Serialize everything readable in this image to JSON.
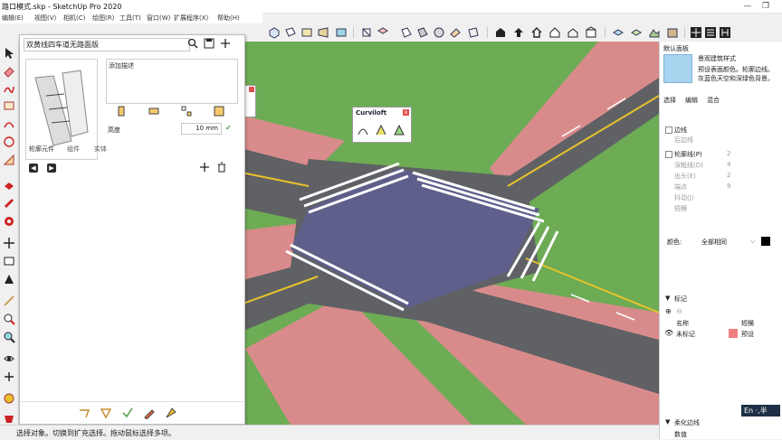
{
  "window": {
    "title": "路口模式.skp - SketchUp Pro 2020",
    "minimize": "—",
    "maximize": "❐"
  },
  "menubar": [
    "编辑(E)",
    "视图(V)",
    "相机(C)",
    "绘图(R)",
    "工具(T)",
    "窗口(W)",
    "扩展程序(X)",
    "帮助(H)"
  ],
  "component_panel": {
    "name": "双黄线四车道无路面版",
    "description": "添加描述",
    "height_label": "高度",
    "height_value": "10 mm",
    "tabs": [
      "轮廓元件",
      "组件",
      "实体"
    ],
    "icons": [
      "search-icon",
      "save-icon",
      "add-icon"
    ],
    "list_icons": [
      "add-icon",
      "delete-icon"
    ]
  },
  "curviloft": {
    "title": "Curviloft",
    "close": "x"
  },
  "right_panel": {
    "style_name": "默认面板",
    "style_title": "景观建筑样式",
    "style_desc_1": "预设表面颜色。轮廓边线。",
    "style_desc_2": "灰蓝色天空和深绿色背景。",
    "tabs": [
      "选择",
      "编辑",
      "混合"
    ],
    "edges_label": "边线",
    "back_edges_label": "后边线",
    "profiles_label": "轮廓线(P)",
    "depth_label": "深粗线(D)",
    "extension_label": "出头(E)",
    "endpoints_label": "端点",
    "jitter_label": "抖动(J)",
    "halo_label": "短横",
    "values": [
      "2",
      "4",
      "2",
      "9"
    ],
    "color_label": "颜色:",
    "color_value": "全部相同",
    "color_swatch": "#000000",
    "tags_section": "标记",
    "tags_col_name": "名称",
    "tags_col_line": "短横",
    "tag_row_name": "未标记",
    "tag_row_line": "预设",
    "tag_color": "#ef7f7f",
    "soften_section": "柔化边线",
    "soften_value": "数值",
    "ime_text": "En ·,半"
  },
  "status": "选择对象。切换到扩充选择。拖动鼠标选择多项。",
  "colors": {
    "grass": "#6dac55",
    "road": "#5f6164",
    "sidewalk": "#d98b8b",
    "crosswalk_center": "#5e5f8a",
    "yellow_line": "#e8c22b"
  }
}
